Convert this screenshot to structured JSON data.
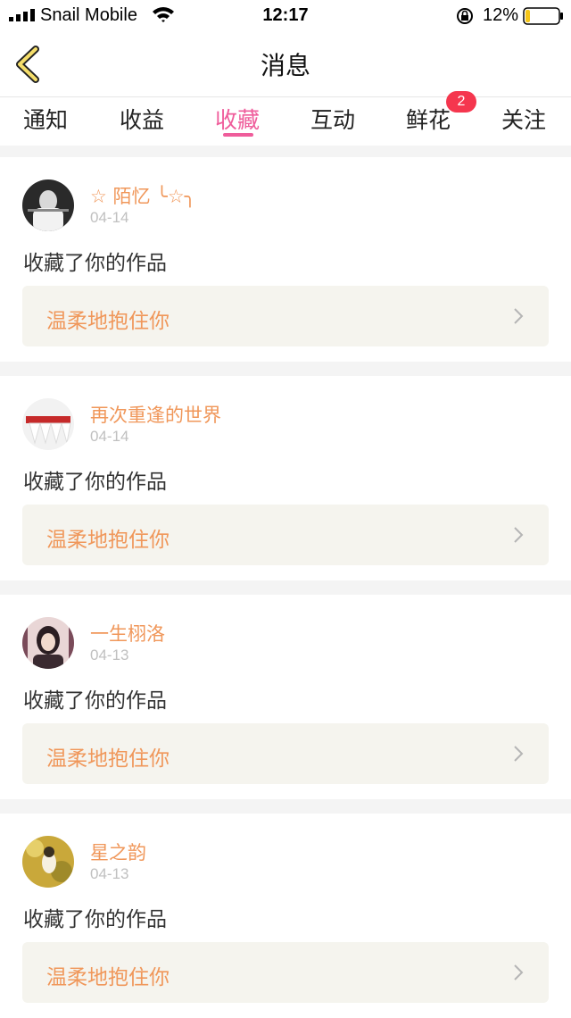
{
  "status_bar": {
    "carrier": "Snail Mobile",
    "time": "12:17",
    "battery_percent": "12%",
    "battery_level": 0.12
  },
  "header": {
    "title": "消息",
    "back_icon": "chevron-left-icon"
  },
  "tabs": [
    {
      "label": "通知",
      "active": false
    },
    {
      "label": "收益",
      "active": false
    },
    {
      "label": "收藏",
      "active": true
    },
    {
      "label": "互动",
      "active": false
    },
    {
      "label": "鲜花",
      "active": false,
      "badge": "2"
    },
    {
      "label": "关注",
      "active": false
    }
  ],
  "items": [
    {
      "username": "☆ 陌忆 ╰☆╮",
      "date": "04-14",
      "action": "收藏了你的作品",
      "work_title": "温柔地抱住你"
    },
    {
      "username": "再次重逢的世界",
      "date": "04-14",
      "action": "收藏了你的作品",
      "work_title": "温柔地抱住你"
    },
    {
      "username": "一生栩洛",
      "date": "04-13",
      "action": "收藏了你的作品",
      "work_title": "温柔地抱住你"
    },
    {
      "username": "星之韵",
      "date": "04-13",
      "action": "收藏了你的作品",
      "work_title": "温柔地抱住你"
    }
  ],
  "colors": {
    "accent": "#ef5d9b",
    "username": "#f0975a",
    "badge": "#f5364e",
    "work_bg": "#f5f4ee"
  }
}
